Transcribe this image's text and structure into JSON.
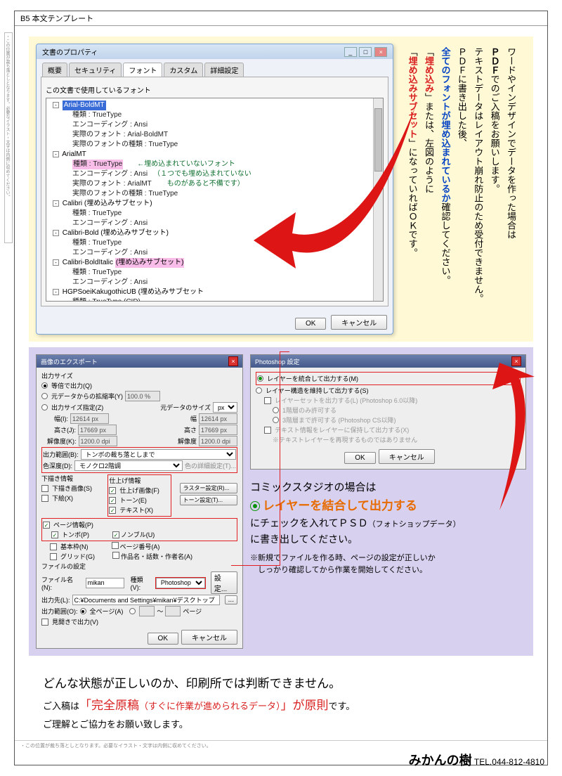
{
  "header": "B5 本文テンプレート",
  "sidenote": "・この位置が裁ち落としとなります。必要なイラスト・文字は内側に収めてください。",
  "vtext": {
    "l1": "ワードやインデザインでデータを作った場合は",
    "l2a": "ＰＤＦ",
    "l2b": "でのご入稿をお願いします。",
    "l3": "テキストデータはレイアウト崩れ防止のため受付できません。",
    "l4": "ＰＤＦに書き出した後、",
    "l5a": "全てのフォントが埋め込まれているか",
    "l5b": "確認してください。",
    "l6a": "「",
    "l6b": "埋め込み",
    "l6c": "」または、左図のように",
    "l7a": "「",
    "l7b": "埋め込みサブセット",
    "l7c": "」になっていればＯＫです。"
  },
  "win": {
    "title": "文書のプロパティ",
    "tabs": [
      "概要",
      "セキュリティ",
      "フォント",
      "カスタム",
      "詳細設定"
    ],
    "listlabel": "この文書で使用しているフォント",
    "fonts": [
      {
        "name": "Arial-BoldMT",
        "hl": "blue",
        "props": [
          "種類 : TrueType",
          "エンコーディング : Ansi",
          "実際のフォント : Arial-BoldMT",
          "実際のフォントの種類 : TrueType"
        ]
      },
      {
        "name": "ArialMT",
        "props": [
          {
            "t": "種類 : TrueType",
            "pink": true
          },
          "エンコーディング : Ansi",
          "実際のフォント : ArialMT",
          "実際のフォントの種類 : TrueType"
        ]
      },
      {
        "name": "Calibri (埋め込みサブセット)",
        "props": [
          "種類 : TrueType",
          "エンコーディング : Ansi"
        ]
      },
      {
        "name": "Calibri-Bold (埋め込みサブセット)",
        "props": [
          "種類 : TrueType",
          "エンコーディング : Ansi"
        ]
      },
      {
        "name": "Calibri-BoldItalic",
        "suffix": "(埋め込みサブセット)",
        "pinksuffix": true,
        "props": [
          "種類 : TrueType",
          "エンコーディング : Ansi"
        ]
      },
      {
        "name": "HGPSoeiKakugothicUB (埋め込みサブセット",
        "props": [
          "種類 : TrueType (CID)"
        ]
      }
    ],
    "note1": "←埋め込まれていないフォント",
    "note2": "（１つでも埋め込まれていない",
    "note3": "  ものがあると不備です）",
    "ok": "OK",
    "cancel": "キャンセル"
  },
  "dlg1": {
    "title": "画像のエクスポート",
    "g_size": "出力サイズ",
    "r1": "等倍で出力(Q)",
    "r2": "元データからの拡縮率(Y)",
    "r2v": "100.0 %",
    "r3": "出力サイズ指定(Z)",
    "r3l": "元データのサイズ",
    "px": "px",
    "wl": "幅(I):",
    "wv": "12614 px",
    "w2": "幅",
    "w2v": "12614 px",
    "hl": "高さ(J):",
    "hv": "17669 px",
    "h2": "高さ",
    "h2v": "17669 px",
    "rl": "解像度(K):",
    "rv": "1200.0 dpi",
    "r2l": "解像度",
    "r2v2": "1200.0 dpi",
    "range": "出力範囲(B):",
    "rangev": "トンボの裁ち落としまで",
    "depth": "色深度(D):",
    "depthv": "モノクロ2階調",
    "depthd": "色の詳細設定(T)...",
    "g_shita": "下描き情報",
    "c_shita": "下描き画像(S)",
    "c_shitax": "下絵(X)",
    "g_shi": "仕上げ情報",
    "c_shi1": "仕上げ画像(F)",
    "c_tone": "トーン(E)",
    "c_text": "テキスト(X)",
    "b_ras": "ラスター設定(R)...",
    "b_tone": "トーン設定(T)...",
    "g_page": "ページ情報(P)",
    "c_tonbo": "トンボ(P)",
    "c_nonbru": "ノンブル(U)",
    "c_basic": "基本枠(N)",
    "c_pageno": "ページ番号(A)",
    "c_grid": "グリッド(G)",
    "c_work": "作品名・話数・作者名(A)",
    "g_file": "ファイルの設定",
    "f_name": "ファイル名(N):",
    "f_namev": "mikan",
    "f_type": "種類(V):",
    "f_typev": "Photoshop",
    "f_set": "設定...",
    "f_dir": "出力先(L):",
    "f_dirv": "C:¥Documents and Settings¥mikan¥デスクトップ",
    "f_range": "出力範囲(O):",
    "f_all": "全ページ(A)",
    "to": "～",
    "pp": "ページ",
    "c_open": "見開きで出力(V)",
    "ok": "OK",
    "cancel": "キャンセル"
  },
  "dlg2": {
    "title": "Photoshop 設定",
    "r1": "レイヤーを統合して出力する(M)",
    "r2": "レイヤー構造を維持して出力する(S)",
    "c1": "レイヤーセットを出力する(L) (Photoshop 6.0以降)",
    "r3": "1階層のみ許可する",
    "r4": "3階層まで許可する (Photoshop CS以降)",
    "c2": "テキスト情報をレイヤーに保持して出力する(X)",
    "warn": "※テキストレイヤーを再現するものではありません",
    "ok": "OK",
    "cancel": "キャンセル"
  },
  "desc": {
    "l1": "コミックスタジオの場合は",
    "l2": "レイヤーを結合して出力する",
    "l3a": "にチェックを入れてＰＳＤ",
    "l3b": "（フォトショップデータ）",
    "l4": "に書き出してください。",
    "n1": "※新規でファイルを作る時、ページの設定が正しいか",
    "n2": "　しっかり確認してから作業を開始してください。"
  },
  "foot": {
    "l1": "どんな状態が正しいのか、印刷所では判断できません。",
    "l2a": "ご入稿は",
    "l2b": "「完全原稿",
    "l2c": "（すぐに作業が進められるデータ）",
    "l2d": "」が原則",
    "l2e": "です。",
    "l3": "ご理解とご協力をお願い致します。"
  },
  "bottom": "・この位置が裁ち落としとなります。必要なイラスト・文字は内側に収めてください。",
  "tel": "TEL.044-812-4810",
  "brand": "みかんの樹"
}
